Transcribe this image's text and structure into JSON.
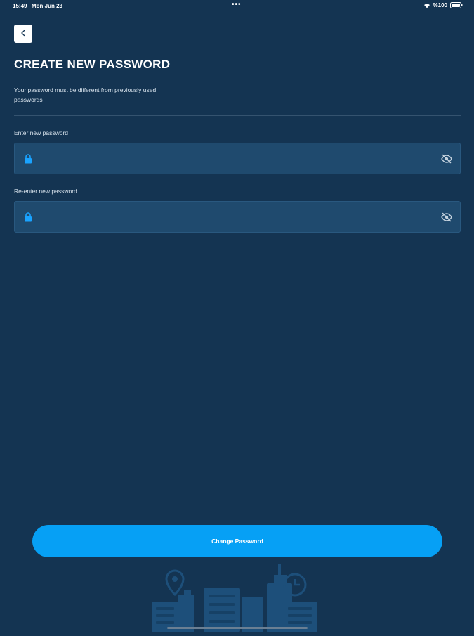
{
  "status_bar": {
    "time": "15:49",
    "date": "Mon Jun 23",
    "dots": "•••",
    "battery": "%100"
  },
  "header": {
    "back_icon": "chevron-left-icon",
    "title": "CREATE NEW PASSWORD",
    "subtitle": "Your password must be different from previously used passwords"
  },
  "form": {
    "new_password": {
      "label": "Enter new password",
      "value": "",
      "leading_icon": "lock-icon",
      "trailing_icon": "eye-off-icon"
    },
    "confirm_password": {
      "label": "Re-enter new password",
      "value": "",
      "leading_icon": "lock-icon",
      "trailing_icon": "eye-off-icon"
    }
  },
  "actions": {
    "submit_label": "Change Password"
  },
  "colors": {
    "background": "#143452",
    "field_background": "#1f4a6e",
    "accent": "#06a0f5",
    "icon_accent": "#1aa3ff",
    "illustration": "#1d4f7a"
  }
}
